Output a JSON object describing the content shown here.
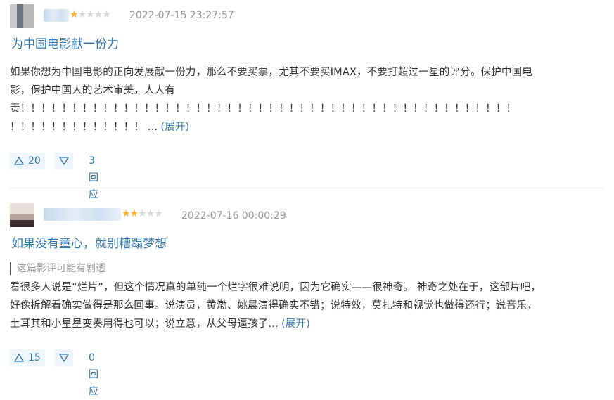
{
  "reviews": [
    {
      "rating": 1,
      "rating_max": 5,
      "date": "2022-07-15 23:27:57",
      "title": "为中国电影献一份力",
      "body_line1": "如果你想为中国电影的正向发展献一份力，那么不要买票，尤其不要买IMAX，不要打超过一星的评分。保护中国电",
      "body_line2": "影，保护中国人的艺术审美，人人有",
      "body_line3": "责！！！！！！！！！！！！！！！！！！！！！！！！！！！！！！！！！！！！！！！！！！！！！！！！",
      "body_line4": "！！！！！！！！！！！！！",
      "ellipsis": "...",
      "expand_label": "(展开)",
      "upvotes": "20",
      "reply_label": "3回应"
    },
    {
      "rating": 2,
      "rating_max": 5,
      "date": "2022-07-16 00:00:29",
      "title": "如果没有童心，就别糟蹋梦想",
      "spoiler_notice": "这篇影评可能有剧透",
      "body_line1": "看很多人说是“烂片”，但这个情况真的单纯一个烂字很难说明，因为它确实——很神奇。 神奇之处在于，这部片吧，",
      "body_line2": "好像拆解看确实做得是那么回事。说演员，黄渤、姚晨演得确实不错；说特效，莫扎特和视觉也做得还行；说音乐，",
      "body_line3": "土耳其和小星星变奏用得也可以；说立意，从父母逼孩子...",
      "expand_label": "(展开)",
      "upvotes": "15",
      "reply_label": "0回应"
    }
  ],
  "icons": {
    "star_filled": "★",
    "star_empty": "★",
    "upvote": "triangle-up-icon",
    "downvote": "triangle-down-icon"
  },
  "colors": {
    "link": "#3377aa",
    "star": "#ffac2d",
    "date": "#999999",
    "vote_bg": "#eef5fb"
  }
}
